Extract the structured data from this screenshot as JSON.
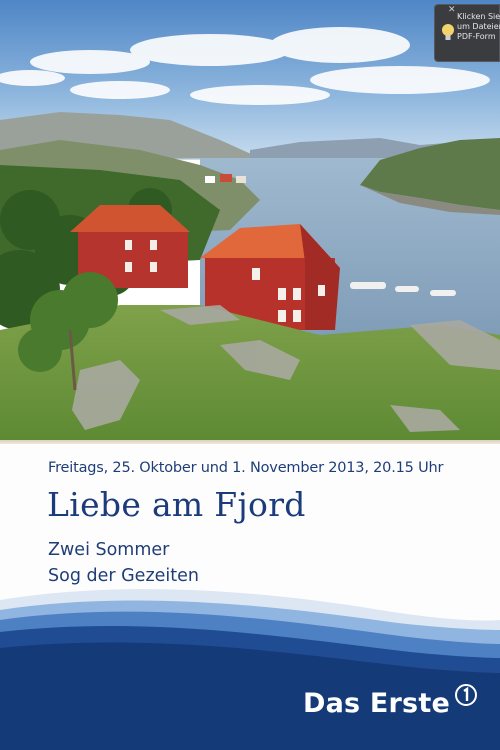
{
  "poster": {
    "date_line": "Freitags, 25. Oktober und 1. November 2013, 20.15 Uhr",
    "title": "Liebe am Fjord",
    "subtitle_1": "Zwei Sommer",
    "subtitle_2": "Sog der Gezeiten",
    "brand": "Das Erste",
    "brand_logo_icon": "ard-one-logo-icon"
  },
  "pdf_notice": {
    "line_1": "Klicken Sie",
    "line_2": "um Dateien",
    "line_3": "PDF-Form",
    "icon": "lightbulb-icon",
    "close_icon": "close-icon"
  },
  "colors": {
    "title_blue": "#1c3b7a",
    "band_blue": "#143a78",
    "light_blue": "#5a8fcf"
  }
}
